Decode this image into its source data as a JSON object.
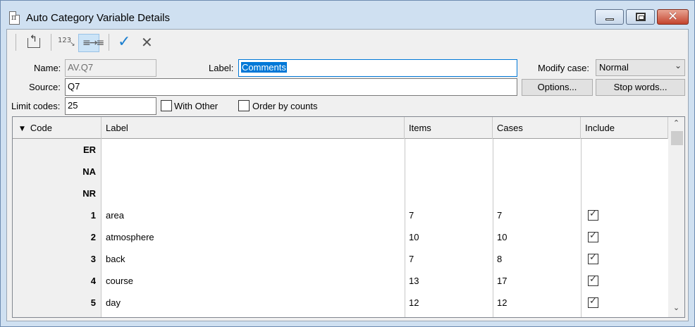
{
  "window": {
    "title": "Auto Category Variable Details",
    "controls": {
      "minimize": "minimize",
      "maximize": "maximize",
      "close": "✕"
    }
  },
  "toolbar": {
    "back_icon": "back-arrow-icon",
    "numbers_icon_text": "123",
    "list_icon_text": "≡→≡",
    "ok_glyph": "✓",
    "cancel_glyph": "✕"
  },
  "form": {
    "name_label": "Name:",
    "name_value": "AV.Q7",
    "label_label": "Label:",
    "label_value": "Comments",
    "modify_case_label": "Modify case:",
    "modify_case_value": "Normal",
    "source_label": "Source:",
    "source_value": "Q7",
    "options_button": "Options...",
    "stop_words_button": "Stop words...",
    "limit_codes_label": "Limit codes:",
    "limit_codes_value": "25",
    "with_other_label": "With Other",
    "order_by_counts_label": "Order by counts"
  },
  "grid": {
    "columns": [
      "Code",
      "Label",
      "Items",
      "Cases",
      "Include"
    ],
    "rows": [
      {
        "code": "ER",
        "label": "",
        "items": "",
        "cases": "",
        "include": null
      },
      {
        "code": "NA",
        "label": "",
        "items": "",
        "cases": "",
        "include": null
      },
      {
        "code": "NR",
        "label": "",
        "items": "",
        "cases": "",
        "include": null
      },
      {
        "code": "1",
        "label": "area",
        "items": "7",
        "cases": "7",
        "include": true
      },
      {
        "code": "2",
        "label": "atmosphere",
        "items": "10",
        "cases": "10",
        "include": true
      },
      {
        "code": "3",
        "label": "back",
        "items": "7",
        "cases": "8",
        "include": true
      },
      {
        "code": "4",
        "label": "course",
        "items": "13",
        "cases": "17",
        "include": true
      },
      {
        "code": "5",
        "label": "day",
        "items": "12",
        "cases": "12",
        "include": true
      }
    ]
  }
}
